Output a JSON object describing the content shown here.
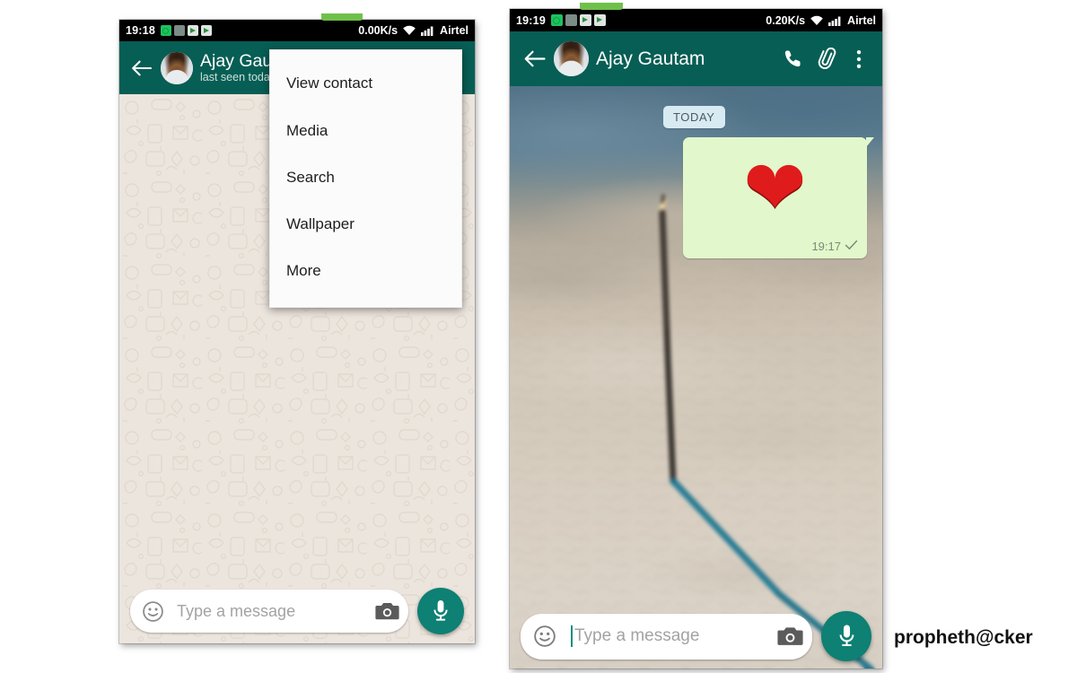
{
  "watermark": {
    "text": "propheth@cker"
  },
  "left_phone": {
    "name": "whatsapp-chat-with-menu-open",
    "statusbar": {
      "clock": "19:18",
      "net_speed": "0.00K/s",
      "carrier": "Airtel",
      "icons": [
        "whatsapp-notification-icon",
        "app-notification-icon",
        "play-store-icon",
        "play-store-icon"
      ],
      "wifi_icon": "wifi-icon",
      "signal_icon": "signal-bars-icon"
    },
    "appbar": {
      "back_icon": "back-arrow-icon",
      "avatar_icon": "contact-avatar",
      "contact_name": "Ajay Gauta",
      "contact_status": "last seen toda"
    },
    "input": {
      "emoji_icon": "emoji-smiley-icon",
      "placeholder": "Type a message",
      "camera_icon": "camera-icon",
      "mic_icon": "microphone-icon"
    },
    "menu": {
      "items": [
        {
          "label": "View contact"
        },
        {
          "label": "Media"
        },
        {
          "label": "Search"
        },
        {
          "label": "Wallpaper"
        },
        {
          "label": "More"
        }
      ]
    }
  },
  "right_phone": {
    "name": "whatsapp-chat-with-photo-wallpaper",
    "statusbar": {
      "clock": "19:19",
      "net_speed": "0.20K/s",
      "carrier": "Airtel",
      "icons": [
        "whatsapp-notification-icon",
        "app-notification-icon",
        "play-store-icon",
        "play-store-icon"
      ],
      "wifi_icon": "wifi-icon",
      "signal_icon": "signal-bars-icon"
    },
    "appbar": {
      "back_icon": "back-arrow-icon",
      "avatar_icon": "contact-avatar",
      "contact_name": "Ajay Gautam",
      "call_icon": "phone-call-icon",
      "attach_icon": "paperclip-attach-icon",
      "overflow_icon": "overflow-menu-icon"
    },
    "chat": {
      "date_chip": "TODAY",
      "messages": [
        {
          "type": "outgoing",
          "emoji": "❤",
          "emoji_name": "red-heart-emoji",
          "time": "19:17",
          "status_icon": "single-check-icon"
        }
      ]
    },
    "input": {
      "emoji_icon": "emoji-smiley-icon",
      "placeholder": "Type a message",
      "camera_icon": "camera-icon",
      "mic_icon": "microphone-icon",
      "caret_visible": true
    }
  },
  "colors": {
    "appbar_green": "#075E54",
    "fab_green": "#0E8074",
    "bubble_green": "#E2F7CB",
    "doodle_bg": "#ECE5DD",
    "date_chip": "#d8eaf2",
    "status_black": "#000000",
    "notch_green": "#6fc04a"
  }
}
